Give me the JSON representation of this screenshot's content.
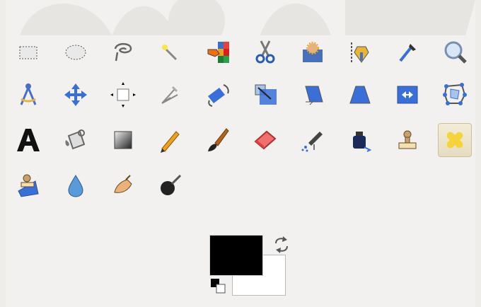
{
  "toolbox": {
    "tools_row1": [
      "rect-select-icon",
      "ellipse-select-icon",
      "free-select-icon",
      "fuzzy-select-icon",
      "select-by-color-icon",
      "scissors-select-icon",
      "foreground-select-icon",
      "paths-icon",
      "color-picker-icon",
      "zoom-icon"
    ],
    "tools_row2": [
      "measure-icon",
      "move-icon",
      "align-icon",
      "crop-icon",
      "rotate-icon",
      "scale-icon",
      "shear-icon",
      "perspective-icon",
      "flip-icon",
      "cage-transform-icon"
    ],
    "tools_row3": [
      "text-icon",
      "bucket-fill-icon",
      "blend-icon",
      "pencil-icon",
      "paintbrush-icon",
      "eraser-icon",
      "airbrush-icon",
      "ink-icon",
      "clone-icon",
      "heal-icon"
    ],
    "tools_row4": [
      "perspective-clone-icon",
      "blur-sharpen-icon",
      "smudge-icon",
      "dodge-burn-icon"
    ],
    "active_tool": "heal-icon",
    "foreground_color": "#000000",
    "background_color": "#ffffff"
  }
}
